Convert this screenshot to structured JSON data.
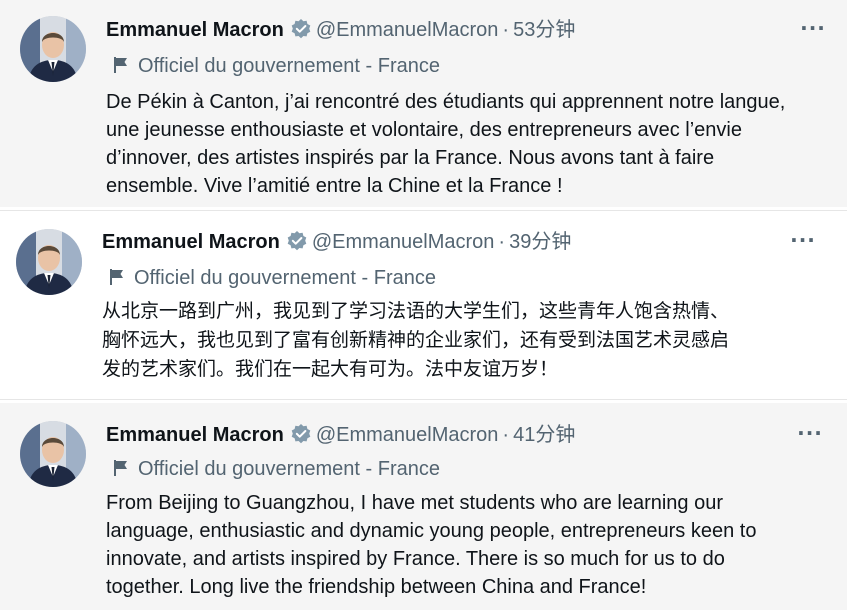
{
  "tweets": [
    {
      "name": "Emmanuel Macron",
      "handle": "@EmmanuelMacron",
      "separator": "·",
      "time": "53分钟",
      "label": "Officiel du gouvernement - France",
      "more": "···",
      "text": "De Pékin à Canton, j’ai rencontré des étudiants qui apprennent notre langue,\nune jeunesse enthousiaste et volontaire, des entrepreneurs avec l’envie\nd’innover, des artistes inspirés par la France. Nous avons tant à faire\nensemble. Vive l’amitié entre la Chine et la France !"
    },
    {
      "name": "Emmanuel Macron",
      "handle": "@EmmanuelMacron",
      "separator": "·",
      "time": "39分钟",
      "label": "Officiel du gouvernement - France",
      "more": "···",
      "text": "从北京一路到广州，我见到了学习法语的大学生们，这些青年人饱含热情、\n胸怀远大，我也见到了富有创新精神的企业家们，还有受到法国艺术灵感启\n发的艺术家们。我们在一起大有可为。法中友谊万岁！"
    },
    {
      "name": "Emmanuel Macron",
      "handle": "@EmmanuelMacron",
      "separator": "·",
      "time": "41分钟",
      "label": "Officiel du gouvernement - France",
      "more": "···",
      "text": "From Beijing to Guangzhou, I have met students who are learning our\nlanguage, enthusiastic and dynamic young people, entrepreneurs keen to\ninnovate, and artists inspired by France. There is so much for us to do\ntogether. Long live the friendship between China and France!"
    }
  ],
  "icons": {
    "verified": "verified-badge-icon",
    "label": "flag-icon",
    "more": "more-options-icon"
  },
  "colors": {
    "verified_badge": "#829aab",
    "secondary_text": "#536471",
    "primary_text": "#0f1419",
    "tweet_background": "#f5f5f5"
  }
}
